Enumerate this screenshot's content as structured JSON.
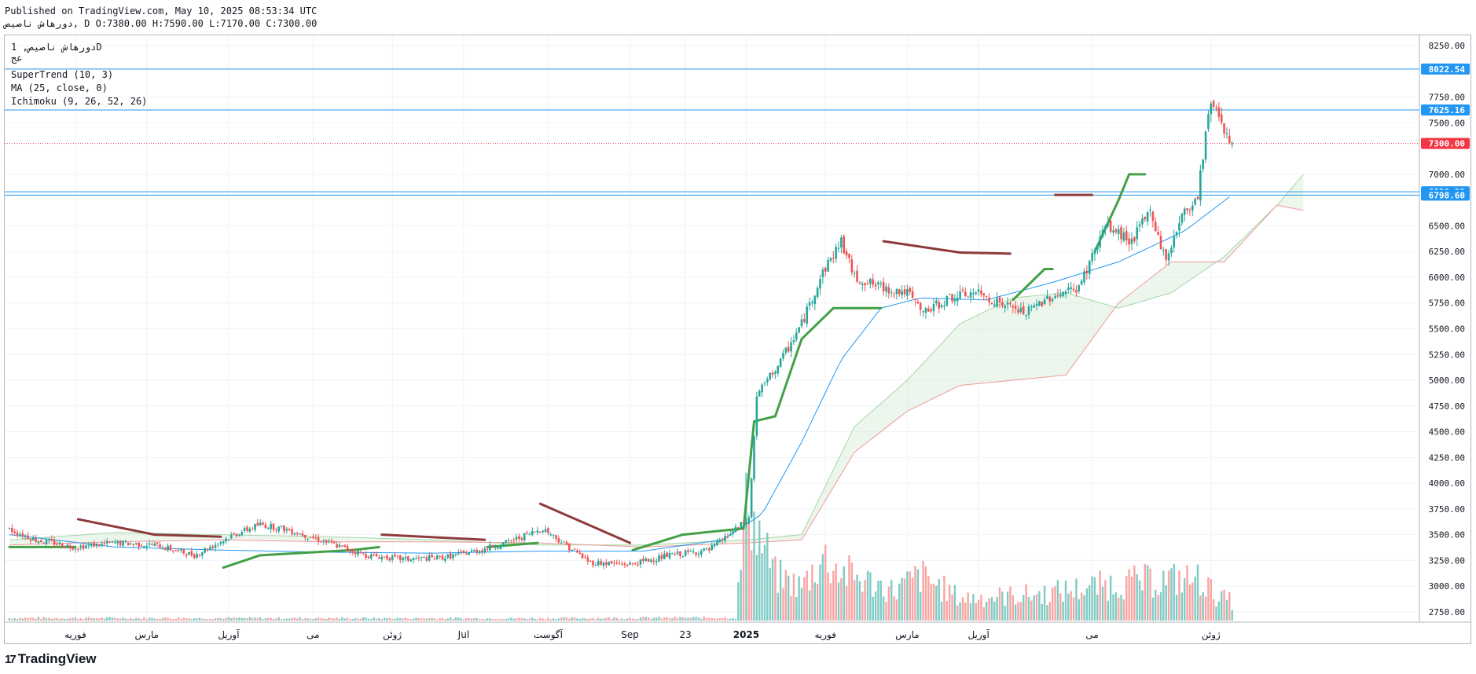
{
  "header": {
    "published": "Published on TradingView.com, May 10, 2025 08:53:34 UTC",
    "symbol_line": "دورهاش ناصیص, D O:7380.00 H:7590.00 L:7170.00 C:7300.00"
  },
  "legend": {
    "symbol": "دورهاش ناصیص, 1D",
    "exchange": "عج",
    "supertrend": "SuperTrend (10, 3)",
    "ma": "MA (25, close, 0)",
    "ichimoku": "Ichimoku (9, 26, 52, 26)"
  },
  "branding": {
    "logo_text": "TradingView",
    "logo_mark": "17"
  },
  "colors": {
    "up": "#26a69a",
    "down": "#ef5350",
    "supertrend_up": "#43a047",
    "supertrend_down": "#8d3a3a",
    "ma": "#2196f3",
    "cloud_green": "#a5d6a7",
    "cloud_red": "#ef9a9a",
    "hline": "#2196f3",
    "last_price": "#f23645"
  },
  "chart_data": {
    "type": "candlestick",
    "ylim": [
      2650,
      8350
    ],
    "y_ticks": [
      "8250.00",
      "7750.00",
      "7500.00",
      "7000.00",
      "6500.00",
      "6250.00",
      "6000.00",
      "5750.00",
      "5500.00",
      "5250.00",
      "5000.00",
      "4750.00",
      "4500.00",
      "4250.00",
      "4000.00",
      "3750.00",
      "3500.00",
      "3250.00",
      "3000.00",
      "2750.00"
    ],
    "x_labels": [
      "فوریه",
      "مارس",
      "آوریل",
      "می",
      "ژوئن",
      "Jul",
      "آگوست",
      "Sep",
      "23",
      "2025",
      "فوریه",
      "مارس",
      "آوریل",
      "می",
      "ژوئن"
    ],
    "x_label_bold_index": 9,
    "horizontal_levels": [
      "8022.54",
      "7625.16",
      "6830.39",
      "6798.60"
    ],
    "last_price": "7300.00",
    "ohlc_last": {
      "open": "7380.00",
      "high": "7590.00",
      "low": "7170.00",
      "close": "7300.00"
    },
    "segments": [
      [
        0,
        3550
      ],
      [
        10,
        3450
      ],
      [
        25,
        3380
      ],
      [
        40,
        3420
      ],
      [
        55,
        3400
      ],
      [
        70,
        3300
      ],
      [
        85,
        3500
      ],
      [
        95,
        3600
      ],
      [
        105,
        3550
      ],
      [
        115,
        3470
      ],
      [
        135,
        3300
      ],
      [
        150,
        3260
      ],
      [
        165,
        3280
      ],
      [
        178,
        3350
      ],
      [
        188,
        3420
      ],
      [
        202,
        3560
      ],
      [
        220,
        3230
      ],
      [
        235,
        3210
      ],
      [
        250,
        3300
      ],
      [
        265,
        3350
      ],
      [
        280,
        3650
      ],
      [
        283,
        4850
      ],
      [
        292,
        5180
      ],
      [
        300,
        5550
      ],
      [
        308,
        6050
      ],
      [
        315,
        6350
      ],
      [
        320,
        6000
      ],
      [
        330,
        5900
      ],
      [
        340,
        5850
      ],
      [
        346,
        5650
      ],
      [
        356,
        5800
      ],
      [
        366,
        5850
      ],
      [
        375,
        5750
      ],
      [
        385,
        5650
      ],
      [
        393,
        5800
      ],
      [
        405,
        5900
      ],
      [
        415,
        6500
      ],
      [
        425,
        6350
      ],
      [
        432,
        6650
      ],
      [
        438,
        6150
      ],
      [
        443,
        6550
      ],
      [
        450,
        6800
      ],
      [
        454,
        7600
      ],
      [
        456,
        7700
      ],
      [
        460,
        7450
      ],
      [
        463,
        7300
      ]
    ],
    "volume_max": 4000,
    "volume_segments": [
      [
        0,
        70
      ],
      [
        200,
        60
      ],
      [
        275,
        80
      ],
      [
        280,
        3600
      ],
      [
        282,
        2600
      ],
      [
        290,
        1200
      ],
      [
        300,
        900
      ],
      [
        308,
        1700
      ],
      [
        315,
        1300
      ],
      [
        335,
        800
      ],
      [
        345,
        1200
      ],
      [
        360,
        600
      ],
      [
        390,
        700
      ],
      [
        420,
        1000
      ],
      [
        440,
        1100
      ],
      [
        452,
        1100
      ],
      [
        456,
        700
      ],
      [
        463,
        500
      ]
    ],
    "supertrend": [
      [
        0,
        3380,
        "up"
      ],
      [
        25,
        3380,
        "up"
      ],
      [
        26,
        3650,
        "down"
      ],
      [
        55,
        3500,
        "down"
      ],
      [
        80,
        3480,
        "down"
      ],
      [
        81,
        3180,
        "up"
      ],
      [
        95,
        3300,
        "up"
      ],
      [
        130,
        3350,
        "up"
      ],
      [
        140,
        3380,
        "up"
      ],
      [
        141,
        3500,
        "down"
      ],
      [
        180,
        3450,
        "down"
      ],
      [
        181,
        3380,
        "up"
      ],
      [
        200,
        3420,
        "up"
      ],
      [
        201,
        3800,
        "down"
      ],
      [
        235,
        3420,
        "down"
      ],
      [
        236,
        3350,
        "up"
      ],
      [
        255,
        3500,
        "up"
      ],
      [
        278,
        3560,
        "up"
      ],
      [
        282,
        4600,
        "up"
      ],
      [
        290,
        4650,
        "up"
      ],
      [
        300,
        5400,
        "up"
      ],
      [
        312,
        5700,
        "up"
      ],
      [
        330,
        5700,
        "up"
      ],
      [
        331,
        6350,
        "down"
      ],
      [
        360,
        6240,
        "down"
      ],
      [
        379,
        6230,
        "down"
      ],
      [
        380,
        5780,
        "up"
      ],
      [
        392,
        6080,
        "up"
      ],
      [
        395,
        6080,
        "up"
      ],
      [
        396,
        6800,
        "down"
      ],
      [
        410,
        6800,
        "down"
      ],
      [
        411,
        6250,
        "up"
      ],
      [
        420,
        6750,
        "up"
      ],
      [
        424,
        7000,
        "up"
      ],
      [
        430,
        7000,
        "up"
      ]
    ],
    "ma": [
      [
        0,
        3500
      ],
      [
        40,
        3380
      ],
      [
        80,
        3350
      ],
      [
        120,
        3330
      ],
      [
        160,
        3320
      ],
      [
        200,
        3340
      ],
      [
        240,
        3340
      ],
      [
        270,
        3450
      ],
      [
        285,
        3700
      ],
      [
        300,
        4400
      ],
      [
        315,
        5200
      ],
      [
        330,
        5700
      ],
      [
        345,
        5800
      ],
      [
        370,
        5780
      ],
      [
        395,
        5950
      ],
      [
        420,
        6150
      ],
      [
        445,
        6450
      ],
      [
        463,
        6800
      ]
    ],
    "cloud": {
      "span_a": [
        [
          0,
          3450
        ],
        [
          40,
          3520
        ],
        [
          80,
          3500
        ],
        [
          120,
          3480
        ],
        [
          160,
          3450
        ],
        [
          200,
          3400
        ],
        [
          240,
          3400
        ],
        [
          280,
          3450
        ],
        [
          300,
          3500
        ],
        [
          320,
          4550
        ],
        [
          340,
          5000
        ],
        [
          360,
          5550
        ],
        [
          380,
          5800
        ],
        [
          400,
          5850
        ],
        [
          420,
          5700
        ],
        [
          440,
          5850
        ],
        [
          460,
          6200
        ],
        [
          480,
          6700
        ],
        [
          490,
          7000
        ]
      ],
      "span_b": [
        [
          0,
          3400
        ],
        [
          40,
          3430
        ],
        [
          80,
          3450
        ],
        [
          120,
          3430
        ],
        [
          160,
          3430
        ],
        [
          200,
          3420
        ],
        [
          240,
          3380
        ],
        [
          280,
          3420
        ],
        [
          300,
          3450
        ],
        [
          320,
          4300
        ],
        [
          340,
          4700
        ],
        [
          360,
          4950
        ],
        [
          380,
          5000
        ],
        [
          400,
          5050
        ],
        [
          420,
          5750
        ],
        [
          440,
          6150
        ],
        [
          460,
          6150
        ],
        [
          480,
          6700
        ],
        [
          490,
          6650
        ]
      ]
    }
  }
}
